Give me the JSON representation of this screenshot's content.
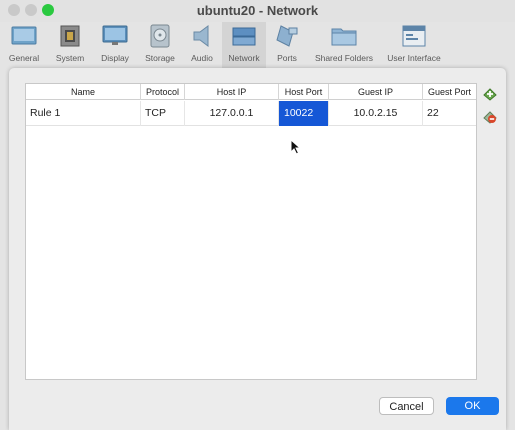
{
  "window": {
    "title": "ubuntu20 - Network"
  },
  "toolbar": {
    "items": [
      {
        "label": "General",
        "icon": "general-icon"
      },
      {
        "label": "System",
        "icon": "system-chip-icon"
      },
      {
        "label": "Display",
        "icon": "display-monitor-icon"
      },
      {
        "label": "Storage",
        "icon": "storage-disk-icon"
      },
      {
        "label": "Audio",
        "icon": "audio-speaker-icon"
      },
      {
        "label": "Network",
        "icon": "network-icon"
      },
      {
        "label": "Ports",
        "icon": "ports-icon"
      },
      {
        "label": "Shared Folders",
        "icon": "shared-folders-icon"
      },
      {
        "label": "User Interface",
        "icon": "user-interface-icon"
      }
    ],
    "active": "Network"
  },
  "table": {
    "columns": [
      "Name",
      "Protocol",
      "Host IP",
      "Host Port",
      "Guest IP",
      "Guest Port"
    ],
    "rows": [
      {
        "name": "Rule 1",
        "protocol": "TCP",
        "host_ip": "127.0.0.1",
        "host_port": "10022",
        "guest_ip": "10.0.2.15",
        "guest_port": "22"
      }
    ],
    "selected_cell": "host_port"
  },
  "buttons": {
    "cancel": "Cancel",
    "ok": "OK"
  },
  "colors": {
    "accent": "#1b78ec",
    "selection": "#1557d6",
    "active_window_button": "#2ac940"
  }
}
